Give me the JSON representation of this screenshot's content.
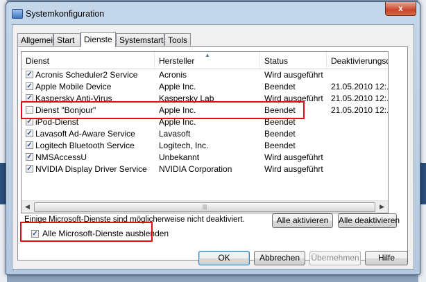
{
  "window": {
    "title": "Systemkonfiguration",
    "close_glyph": "x"
  },
  "tabs": [
    {
      "label": "Allgemein",
      "active": false
    },
    {
      "label": "Start",
      "active": false
    },
    {
      "label": "Dienste",
      "active": true
    },
    {
      "label": "Systemstart",
      "active": false
    },
    {
      "label": "Tools",
      "active": false
    }
  ],
  "columns": {
    "dienst": "Dienst",
    "hersteller": "Hersteller",
    "status": "Status",
    "deaktiviert": "Deaktivierungsd"
  },
  "services": [
    {
      "checked": true,
      "name": "Acronis Scheduler2 Service",
      "vendor": "Acronis",
      "status": "Wird ausgeführt",
      "date": ""
    },
    {
      "checked": true,
      "name": "Apple Mobile Device",
      "vendor": "Apple Inc.",
      "status": "Beendet",
      "date": "21.05.2010 12:..."
    },
    {
      "checked": true,
      "name": "Kaspersky Anti-Virus",
      "vendor": "Kaspersky Lab",
      "status": "Wird ausgeführt",
      "date": "21.05.2010 12:..."
    },
    {
      "checked": false,
      "name": "Dienst \"Bonjour\"",
      "vendor": "Apple Inc.",
      "status": "Beendet",
      "date": "21.05.2010 12:..."
    },
    {
      "checked": true,
      "name": "iPod-Dienst",
      "vendor": "Apple Inc.",
      "status": "Beendet",
      "date": ""
    },
    {
      "checked": true,
      "name": "Lavasoft Ad-Aware Service",
      "vendor": "Lavasoft",
      "status": "Beendet",
      "date": ""
    },
    {
      "checked": true,
      "name": "Logitech Bluetooth Service",
      "vendor": "Logitech, Inc.",
      "status": "Beendet",
      "date": ""
    },
    {
      "checked": true,
      "name": "NMSAccessU",
      "vendor": "Unbekannt",
      "status": "Wird ausgeführt",
      "date": ""
    },
    {
      "checked": true,
      "name": "NVIDIA Display Driver Service",
      "vendor": "NVIDIA Corporation",
      "status": "Wird ausgeführt",
      "date": ""
    }
  ],
  "info_text": "Einige Microsoft-Dienste sind möglicherweise nicht deaktiviert.",
  "buttons": {
    "enable_all": "Alle aktivieren",
    "disable_all": "Alle deaktivieren",
    "ok": "OK",
    "cancel": "Abbrechen",
    "apply": "Übernehmen",
    "help": "Hilfe"
  },
  "hide_ms": {
    "checked": true,
    "label": "Alle Microsoft-Dienste ausblenden"
  },
  "colors": {
    "highlight": "#dd1111",
    "check": "#2d4e87"
  }
}
